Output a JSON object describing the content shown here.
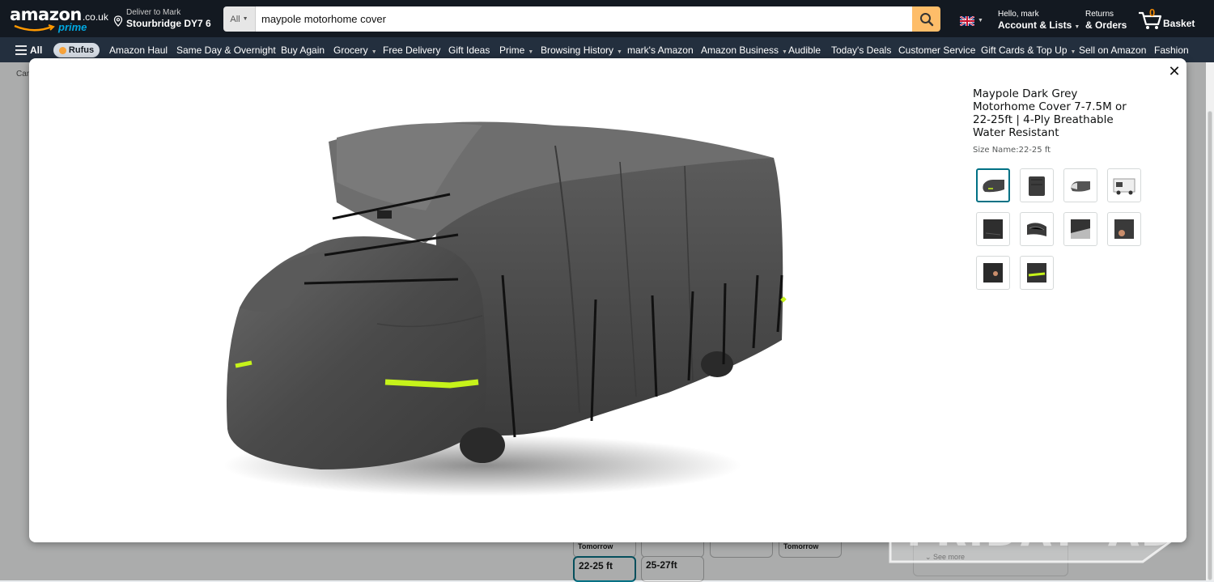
{
  "header": {
    "logo_text": "amazon",
    "logo_tld": ".co.uk",
    "logo_prime": "prime",
    "deliver_line1": "Deliver to Mark",
    "deliver_line2": "Stourbridge DY7 6",
    "search_category": "All",
    "search_value": "maypole motorhome cover",
    "account_line1": "Hello, mark",
    "account_line2": "Account & Lists",
    "returns_line1": "Returns",
    "returns_line2": "& Orders",
    "basket_count": "0",
    "basket_label": "Basket",
    "icons": {
      "location": "location-pin-icon",
      "search": "search-icon",
      "flag": "uk-flag-icon",
      "cart": "cart-icon"
    },
    "colors": {
      "bar": "#131921",
      "search_button": "#febd69",
      "prime": "#00a8e1",
      "count": "#f08804"
    }
  },
  "nav": {
    "all_label": "All",
    "rufus_label": "Rufus",
    "items": [
      {
        "label": "Amazon Haul",
        "caret": false
      },
      {
        "label": "Same Day & Overnight",
        "caret": false
      },
      {
        "label": "Buy Again",
        "caret": false
      },
      {
        "label": "Grocery",
        "caret": true
      },
      {
        "label": "Free Delivery",
        "caret": false
      },
      {
        "label": "Gift Ideas",
        "caret": false
      },
      {
        "label": "Prime",
        "caret": true
      },
      {
        "label": "Browsing History",
        "caret": true
      },
      {
        "label": "mark's Amazon",
        "caret": false
      },
      {
        "label": "Amazon Business",
        "caret": true
      },
      {
        "label": "Audible",
        "caret": false
      },
      {
        "label": "Today's Deals",
        "caret": false
      },
      {
        "label": "Customer Service",
        "caret": false
      },
      {
        "label": "Gift Cards & Top Up",
        "caret": true
      },
      {
        "label": "Sell on Amazon",
        "caret": false
      },
      {
        "label": "Fashion",
        "caret": false
      }
    ],
    "color": "#232f3e"
  },
  "background": {
    "crumb": "Car",
    "tomorrow_1": "Tomorrow",
    "tomorrow_2": "Tomorrow",
    "size_1": "22-25 ft",
    "size_2": "25-27ft",
    "see_more": "See more"
  },
  "modal": {
    "close_label": "✕",
    "product_title": "Maypole Dark Grey Motorhome Cover 7-7.5M or 22-25ft | 4-Ply Breathable Water Resistant",
    "size_name": "Size Name:22-25 ft",
    "thumbnail_count": 10,
    "selected_thumbnail": 1,
    "accent_color": "#007185",
    "reflective_strip_color": "#c6f31a"
  },
  "watermark": {
    "text": "FRIDAY•AD"
  }
}
